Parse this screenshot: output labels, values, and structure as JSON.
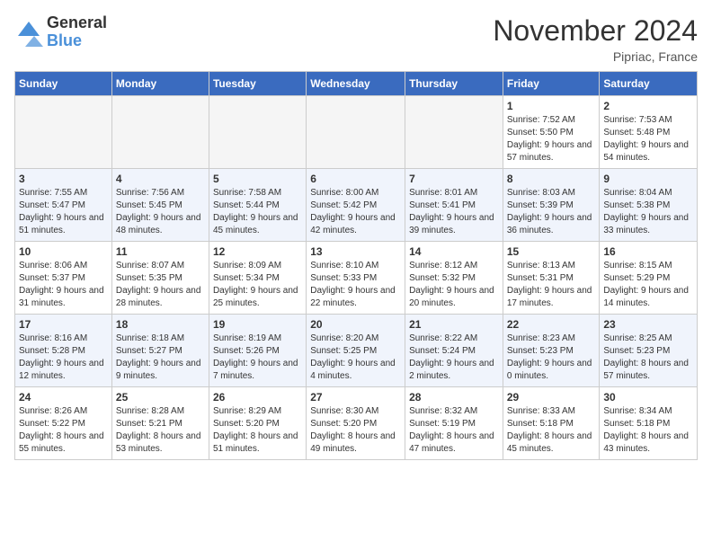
{
  "logo": {
    "general": "General",
    "blue": "Blue"
  },
  "title": "November 2024",
  "location": "Pipriac, France",
  "days_of_week": [
    "Sunday",
    "Monday",
    "Tuesday",
    "Wednesday",
    "Thursday",
    "Friday",
    "Saturday"
  ],
  "weeks": [
    [
      {
        "num": "",
        "info": ""
      },
      {
        "num": "",
        "info": ""
      },
      {
        "num": "",
        "info": ""
      },
      {
        "num": "",
        "info": ""
      },
      {
        "num": "",
        "info": ""
      },
      {
        "num": "1",
        "info": "Sunrise: 7:52 AM\nSunset: 5:50 PM\nDaylight: 9 hours and 57 minutes."
      },
      {
        "num": "2",
        "info": "Sunrise: 7:53 AM\nSunset: 5:48 PM\nDaylight: 9 hours and 54 minutes."
      }
    ],
    [
      {
        "num": "3",
        "info": "Sunrise: 7:55 AM\nSunset: 5:47 PM\nDaylight: 9 hours and 51 minutes."
      },
      {
        "num": "4",
        "info": "Sunrise: 7:56 AM\nSunset: 5:45 PM\nDaylight: 9 hours and 48 minutes."
      },
      {
        "num": "5",
        "info": "Sunrise: 7:58 AM\nSunset: 5:44 PM\nDaylight: 9 hours and 45 minutes."
      },
      {
        "num": "6",
        "info": "Sunrise: 8:00 AM\nSunset: 5:42 PM\nDaylight: 9 hours and 42 minutes."
      },
      {
        "num": "7",
        "info": "Sunrise: 8:01 AM\nSunset: 5:41 PM\nDaylight: 9 hours and 39 minutes."
      },
      {
        "num": "8",
        "info": "Sunrise: 8:03 AM\nSunset: 5:39 PM\nDaylight: 9 hours and 36 minutes."
      },
      {
        "num": "9",
        "info": "Sunrise: 8:04 AM\nSunset: 5:38 PM\nDaylight: 9 hours and 33 minutes."
      }
    ],
    [
      {
        "num": "10",
        "info": "Sunrise: 8:06 AM\nSunset: 5:37 PM\nDaylight: 9 hours and 31 minutes."
      },
      {
        "num": "11",
        "info": "Sunrise: 8:07 AM\nSunset: 5:35 PM\nDaylight: 9 hours and 28 minutes."
      },
      {
        "num": "12",
        "info": "Sunrise: 8:09 AM\nSunset: 5:34 PM\nDaylight: 9 hours and 25 minutes."
      },
      {
        "num": "13",
        "info": "Sunrise: 8:10 AM\nSunset: 5:33 PM\nDaylight: 9 hours and 22 minutes."
      },
      {
        "num": "14",
        "info": "Sunrise: 8:12 AM\nSunset: 5:32 PM\nDaylight: 9 hours and 20 minutes."
      },
      {
        "num": "15",
        "info": "Sunrise: 8:13 AM\nSunset: 5:31 PM\nDaylight: 9 hours and 17 minutes."
      },
      {
        "num": "16",
        "info": "Sunrise: 8:15 AM\nSunset: 5:29 PM\nDaylight: 9 hours and 14 minutes."
      }
    ],
    [
      {
        "num": "17",
        "info": "Sunrise: 8:16 AM\nSunset: 5:28 PM\nDaylight: 9 hours and 12 minutes."
      },
      {
        "num": "18",
        "info": "Sunrise: 8:18 AM\nSunset: 5:27 PM\nDaylight: 9 hours and 9 minutes."
      },
      {
        "num": "19",
        "info": "Sunrise: 8:19 AM\nSunset: 5:26 PM\nDaylight: 9 hours and 7 minutes."
      },
      {
        "num": "20",
        "info": "Sunrise: 8:20 AM\nSunset: 5:25 PM\nDaylight: 9 hours and 4 minutes."
      },
      {
        "num": "21",
        "info": "Sunrise: 8:22 AM\nSunset: 5:24 PM\nDaylight: 9 hours and 2 minutes."
      },
      {
        "num": "22",
        "info": "Sunrise: 8:23 AM\nSunset: 5:23 PM\nDaylight: 9 hours and 0 minutes."
      },
      {
        "num": "23",
        "info": "Sunrise: 8:25 AM\nSunset: 5:23 PM\nDaylight: 8 hours and 57 minutes."
      }
    ],
    [
      {
        "num": "24",
        "info": "Sunrise: 8:26 AM\nSunset: 5:22 PM\nDaylight: 8 hours and 55 minutes."
      },
      {
        "num": "25",
        "info": "Sunrise: 8:28 AM\nSunset: 5:21 PM\nDaylight: 8 hours and 53 minutes."
      },
      {
        "num": "26",
        "info": "Sunrise: 8:29 AM\nSunset: 5:20 PM\nDaylight: 8 hours and 51 minutes."
      },
      {
        "num": "27",
        "info": "Sunrise: 8:30 AM\nSunset: 5:20 PM\nDaylight: 8 hours and 49 minutes."
      },
      {
        "num": "28",
        "info": "Sunrise: 8:32 AM\nSunset: 5:19 PM\nDaylight: 8 hours and 47 minutes."
      },
      {
        "num": "29",
        "info": "Sunrise: 8:33 AM\nSunset: 5:18 PM\nDaylight: 8 hours and 45 minutes."
      },
      {
        "num": "30",
        "info": "Sunrise: 8:34 AM\nSunset: 5:18 PM\nDaylight: 8 hours and 43 minutes."
      }
    ]
  ]
}
